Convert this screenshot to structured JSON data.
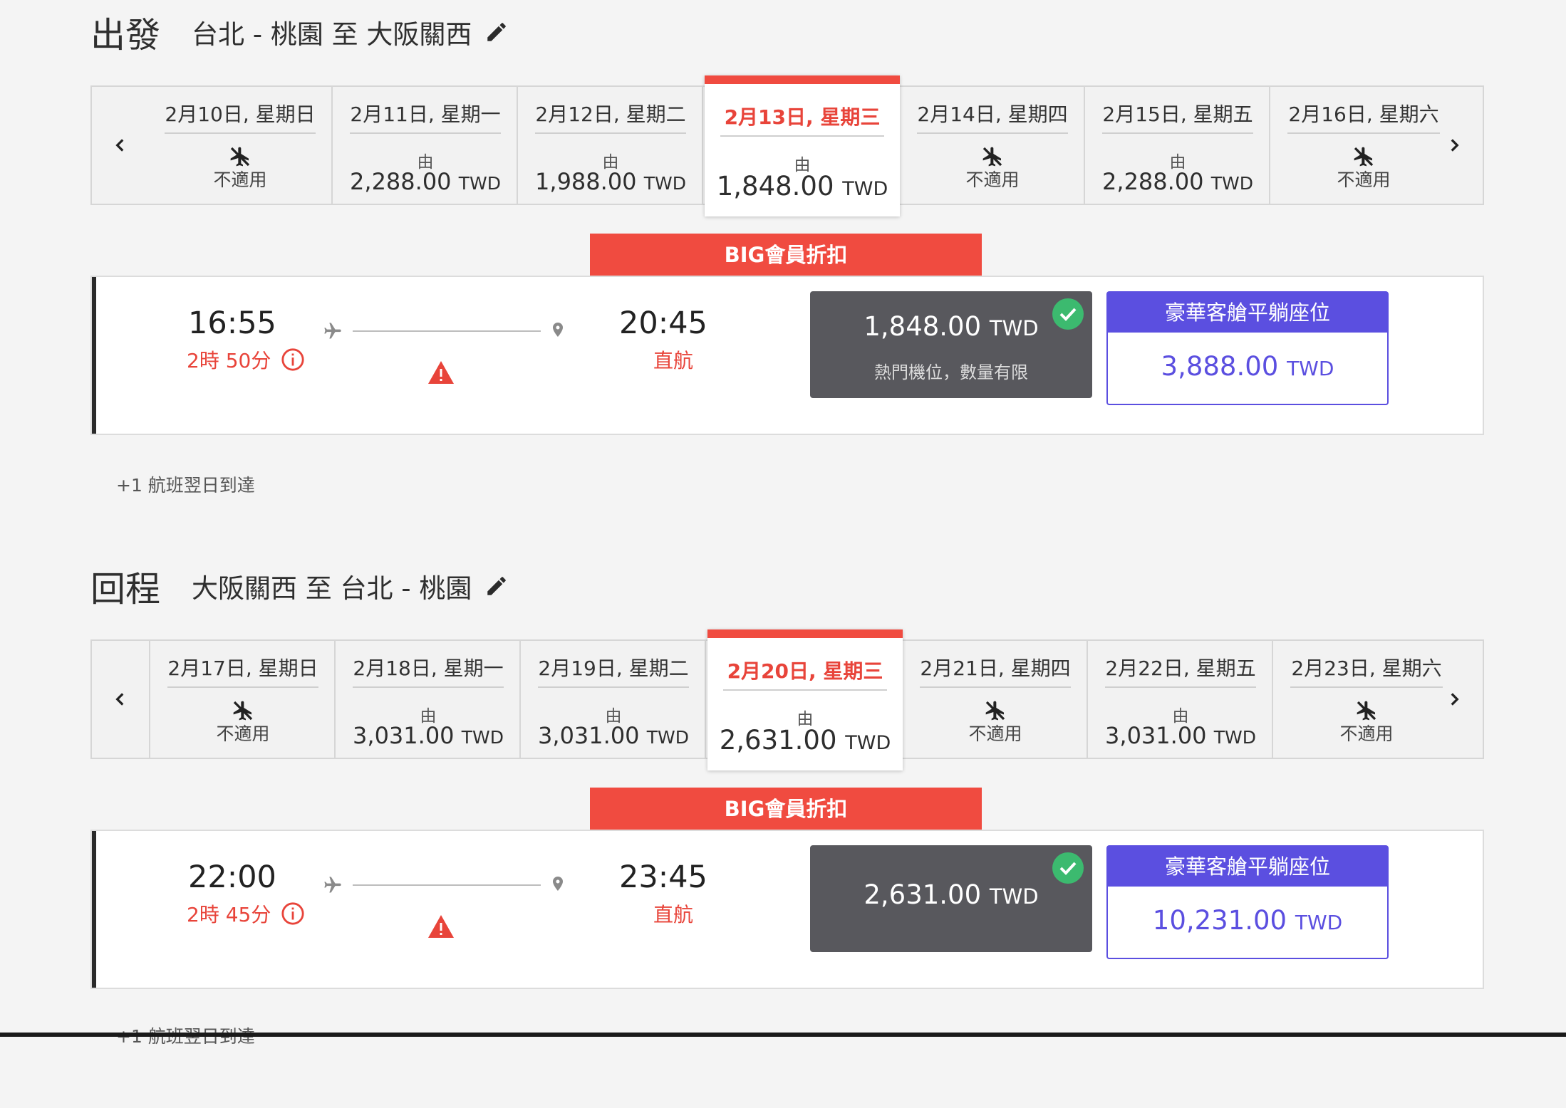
{
  "outbound": {
    "label": "出發",
    "route": "台北 - 桃園 至 大阪關西",
    "dates": [
      {
        "date": "2月10日, 星期日",
        "available": false,
        "na_text": "不適用"
      },
      {
        "date": "2月11日, 星期一",
        "available": true,
        "from": "由",
        "amount": "2,288.00",
        "currency": "TWD"
      },
      {
        "date": "2月12日, 星期二",
        "available": true,
        "from": "由",
        "amount": "1,988.00",
        "currency": "TWD"
      },
      {
        "date": "2月13日, 星期三",
        "available": true,
        "from": "由",
        "amount": "1,848.00",
        "currency": "TWD",
        "selected": true
      },
      {
        "date": "2月14日, 星期四",
        "available": false,
        "na_text": "不適用"
      },
      {
        "date": "2月15日, 星期五",
        "available": true,
        "from": "由",
        "amount": "2,288.00",
        "currency": "TWD"
      },
      {
        "date": "2月16日, 星期六",
        "available": false,
        "na_text": "不適用"
      }
    ],
    "badge": "BIG會員折扣",
    "flight": {
      "depart": "16:55",
      "duration": "2時 50分",
      "arrive": "20:45",
      "stops": "直航",
      "economy_amount": "1,848.00",
      "economy_currency": "TWD",
      "economy_note": "熱門機位，數量有限",
      "premium_label": "豪華客艙平躺座位",
      "premium_amount": "3,888.00",
      "premium_currency": "TWD"
    },
    "footnote": "+1 航班翌日到達"
  },
  "return": {
    "label": "回程",
    "route": "大阪關西 至 台北 - 桃園",
    "dates": [
      {
        "date": "2月17日, 星期日",
        "available": false,
        "na_text": "不適用"
      },
      {
        "date": "2月18日, 星期一",
        "available": true,
        "from": "由",
        "amount": "3,031.00",
        "currency": "TWD"
      },
      {
        "date": "2月19日, 星期二",
        "available": true,
        "from": "由",
        "amount": "3,031.00",
        "currency": "TWD"
      },
      {
        "date": "2月20日, 星期三",
        "available": true,
        "from": "由",
        "amount": "2,631.00",
        "currency": "TWD",
        "selected": true
      },
      {
        "date": "2月21日, 星期四",
        "available": false,
        "na_text": "不適用"
      },
      {
        "date": "2月22日, 星期五",
        "available": true,
        "from": "由",
        "amount": "3,031.00",
        "currency": "TWD"
      },
      {
        "date": "2月23日, 星期六",
        "available": false,
        "na_text": "不適用"
      }
    ],
    "badge": "BIG會員折扣",
    "flight": {
      "depart": "22:00",
      "duration": "2時 45分",
      "arrive": "23:45",
      "stops": "直航",
      "economy_amount": "2,631.00",
      "economy_currency": "TWD",
      "premium_label": "豪華客艙平躺座位",
      "premium_amount": "10,231.00",
      "premium_currency": "TWD"
    },
    "footnote": "+1 航班翌日到達"
  },
  "colors": {
    "accent_red": "#f04b40",
    "premium_purple": "#5b4fe0",
    "economy_card": "#58585d",
    "check_green": "#3cba6f"
  },
  "icons": {
    "edit": "pencil-icon",
    "prev": "chevron-left-icon",
    "next": "chevron-right-icon",
    "not_available": "no-flight-icon",
    "depart": "plane-icon",
    "arrive": "location-pin-icon",
    "warning": "warning-icon",
    "info": "info-icon",
    "selected": "check-circle-icon"
  }
}
